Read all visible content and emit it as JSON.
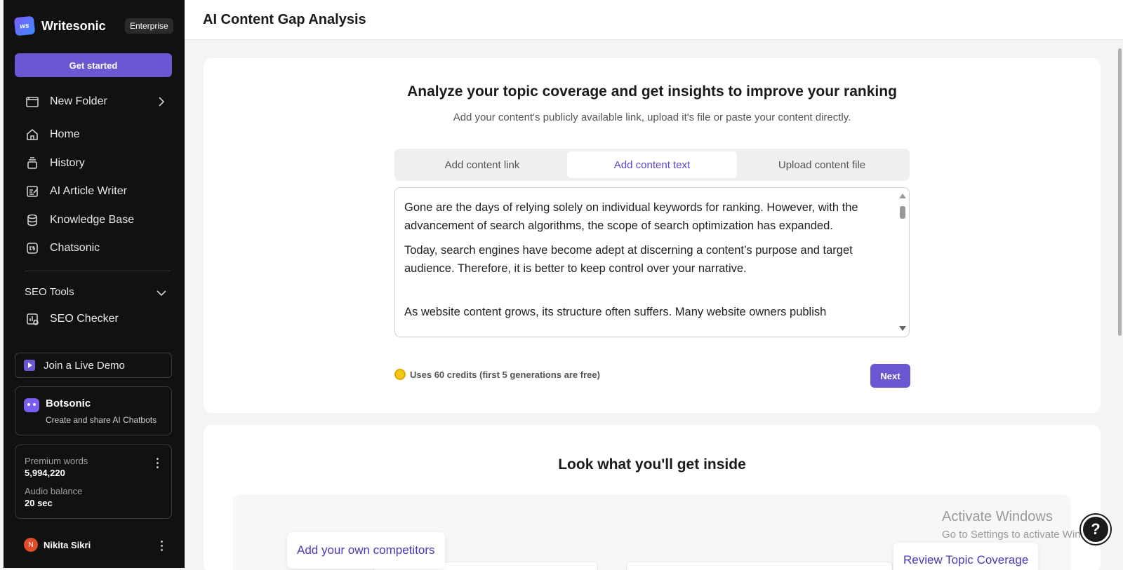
{
  "sidebar": {
    "brand": "Writesonic",
    "logo_text": "ws",
    "badge": "Enterprise",
    "get_started": "Get started",
    "folder": "New Folder",
    "items": [
      {
        "label": "Home",
        "icon": "home-icon"
      },
      {
        "label": "History",
        "icon": "history-icon"
      },
      {
        "label": "AI Article Writer",
        "icon": "article-icon"
      },
      {
        "label": "Knowledge Base",
        "icon": "database-icon"
      },
      {
        "label": "Chatsonic",
        "icon": "chatsonic-icon"
      }
    ],
    "section": "SEO Tools",
    "seo_checker": "SEO Checker",
    "demo": "Join a Live Demo",
    "botsonic": {
      "title": "Botsonic",
      "subtitle": "Create and share AI Chatbots"
    },
    "balance": {
      "premium_label": "Premium words",
      "premium_value": "5,994,220",
      "audio_label": "Audio balance",
      "audio_value": "20 sec"
    },
    "user": {
      "initial": "N",
      "name": "Nikita Sikri"
    }
  },
  "header": {
    "title": "AI Content Gap Analysis"
  },
  "main": {
    "heading": "Analyze your topic coverage and get insights to improve your ranking",
    "subheading": "Add your content's publicly available link, upload it's file or paste your content directly.",
    "tabs": [
      {
        "label": "Add content link",
        "active": false
      },
      {
        "label": "Add content text",
        "active": true
      },
      {
        "label": "Upload content file",
        "active": false
      }
    ],
    "editor_paragraphs": [
      "Gone are the days of relying solely on individual keywords for ranking. However, with the advancement of search algorithms, the scope of search optimization has expanded.",
      "Today, search engines have become adept at discerning a content’s purpose and target audience. Therefore, it is better to keep control over your narrative.",
      "As website content grows, its structure often suffers. Many website owners publish"
    ],
    "credits": "Uses 60 credits (first 5 generations are free)",
    "next": "Next"
  },
  "inside": {
    "heading": "Look what you'll get inside",
    "pill_left": "Add your own competitors",
    "pill_right": "Review Topic Coverage"
  },
  "watermark": {
    "title": "Activate Windows",
    "subtitle": "Go to Settings to activate Windows."
  },
  "help": "?",
  "colors": {
    "accent": "#6b57d2",
    "sidebar_bg": "#111111",
    "active_tab_text": "#5b46c7"
  }
}
